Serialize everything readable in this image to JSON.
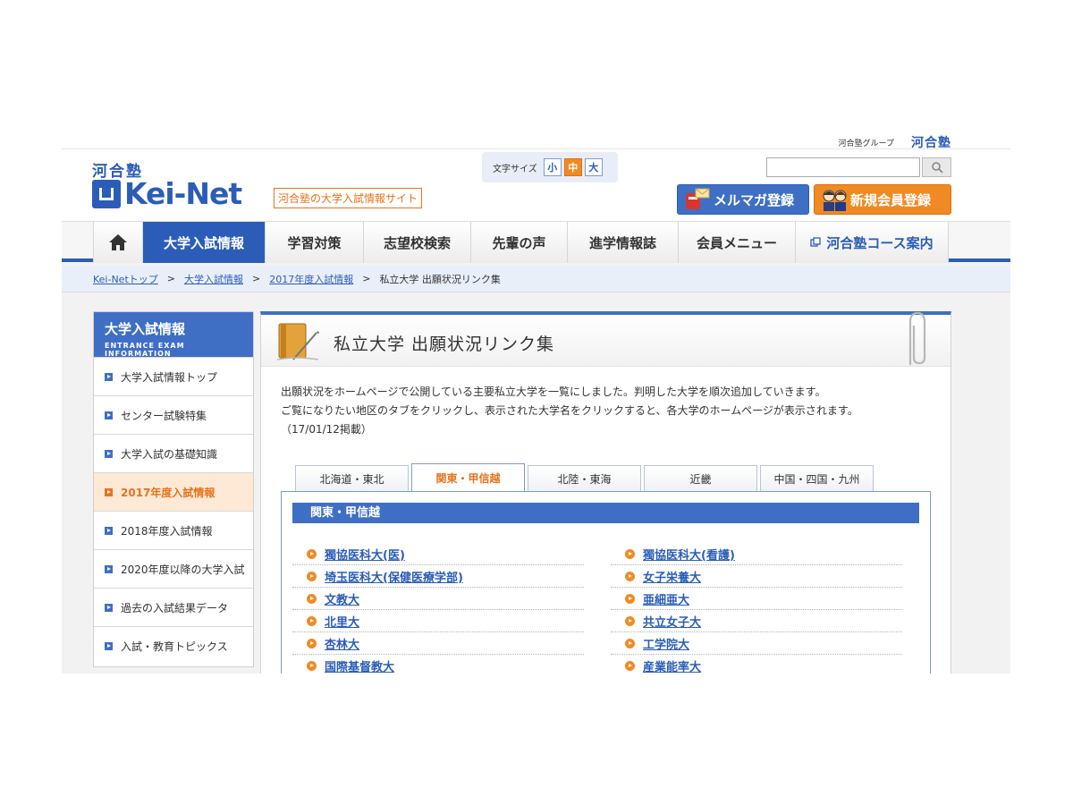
{
  "topbar": {
    "group_label": "河合塾グループ",
    "group_logo": "河合塾"
  },
  "header": {
    "brand_sub": "河合塾",
    "logo_text": "Kei-Net",
    "tagline": "河合塾の大学入試情報サイト",
    "fontsize": {
      "label": "文字サイズ",
      "small": "小",
      "medium": "中",
      "large": "大",
      "selected": "中"
    },
    "search": {
      "value": "",
      "placeholder": ""
    },
    "mail_button": "メルマガ登録",
    "join_button": "新規会員登録"
  },
  "nav": {
    "items": [
      "大学入試情報",
      "学習対策",
      "志望校検索",
      "先輩の声",
      "進学情報誌",
      "会員メニュー"
    ],
    "active": "大学入試情報",
    "course": "河合塾コース案内"
  },
  "breadcrumb": {
    "items": [
      "Kei-Netトップ",
      "大学入試情報",
      "2017年度入試情報"
    ],
    "current": "私立大学 出願状況リンク集"
  },
  "sidebar": {
    "title": "大学入試情報",
    "subtitle": "ENTRANCE EXAM INFORMATION",
    "items": [
      "大学入試情報トップ",
      "センター試験特集",
      "大学入試の基礎知識",
      "2017年度入試情報",
      "2018年度入試情報",
      "2020年度以降の大学入試",
      "過去の入試結果データ",
      "入試・教育トピックス"
    ],
    "active": "2017年度入試情報"
  },
  "main": {
    "title": "私立大学 出願状況リンク集",
    "intro": [
      "出願状況をホームページで公開している主要私立大学を一覧にしました。判明した大学を順次追加していきます。",
      "ご覧になりたい地区のタブをクリックし、表示された大学名をクリックすると、各大学のホームページが表示されます。",
      "（17/01/12掲載）"
    ],
    "tabs": [
      "北海道・東北",
      "関東・甲信越",
      "北陸・東海",
      "近畿",
      "中国・四国・九州"
    ],
    "active_tab": "関東・甲信越",
    "panel_title": "関東・甲信越",
    "left_list": [
      "獨協医科大(医)",
      "埼玉医科大(保健医療学部)",
      "文教大",
      "北里大",
      "杏林大",
      "国際基督教大"
    ],
    "right_list": [
      "獨協医科大(看護)",
      "女子栄養大",
      "亜細亜大",
      "共立女子大",
      "工学院大",
      "産業能率大"
    ]
  },
  "colors": {
    "brand_blue": "#2b5db8",
    "accent_orange": "#f08a24",
    "crumb_bg": "#e9eff9"
  }
}
